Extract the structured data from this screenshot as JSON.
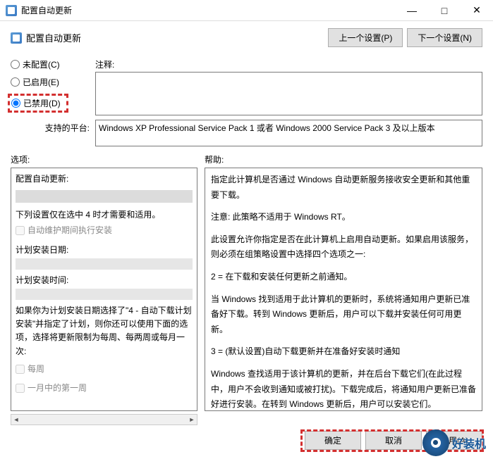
{
  "window": {
    "title": "配置自动更新",
    "minimize": "—",
    "maximize": "□",
    "close": "✕"
  },
  "header": {
    "subtitle": "配置自动更新",
    "prev_btn": "上一个设置(P)",
    "next_btn": "下一个设置(N)"
  },
  "radios": {
    "not_configured": "未配置(C)",
    "enabled": "已启用(E)",
    "disabled": "已禁用(D)"
  },
  "comment": {
    "label": "注释:",
    "value": ""
  },
  "platform": {
    "label": "支持的平台:",
    "value": "Windows XP Professional Service Pack 1 或者 Windows 2000 Service Pack 3 及以上版本"
  },
  "sections": {
    "options_label": "选项:",
    "help_label": "帮助:"
  },
  "options": {
    "title": "配置自动更新:",
    "note": "下列设置仅在选中 4 时才需要和适用。",
    "chk_auto_maint": "自动维护期间执行安装",
    "schedule_day": "计划安装日期:",
    "schedule_time": "计划安装时间:",
    "para": "如果你为计划安装日期选择了\"4 - 自动下载计划安装\"并指定了计划，则你还可以使用下面的选项，选择将更新限制为每周、每两周或每月一次:",
    "chk_weekly": "每周",
    "chk_first_week": "一月中的第一周"
  },
  "help": {
    "p1": "指定此计算机是否通过 Windows 自动更新服务接收安全更新和其他重要下载。",
    "p2": "注意: 此策略不适用于 Windows RT。",
    "p3": "此设置允许你指定是否在此计算机上启用自动更新。如果启用该服务，则必须在组策略设置中选择四个选项之一:",
    "p4": "2 = 在下载和安装任何更新之前通知。",
    "p5": "  当 Windows 找到适用于此计算机的更新时，系统将通知用户更新已准备好下载。转到 Windows 更新后，用户可以下载并安装任何可用更新。",
    "p6": "3 = (默认设置)自动下载更新并在准备好安装时通知",
    "p7": "  Windows 查找适用于该计算机的更新，并在后台下载它们(在此过程中，用户不会收到通知或被打扰)。下载完成后，将通知用户更新已准备好进行安装。在转到 Windows 更新后，用户可以安装它们。"
  },
  "footer": {
    "ok": "确定",
    "cancel": "取消",
    "apply": "应用(A)"
  },
  "branding": "好装机"
}
